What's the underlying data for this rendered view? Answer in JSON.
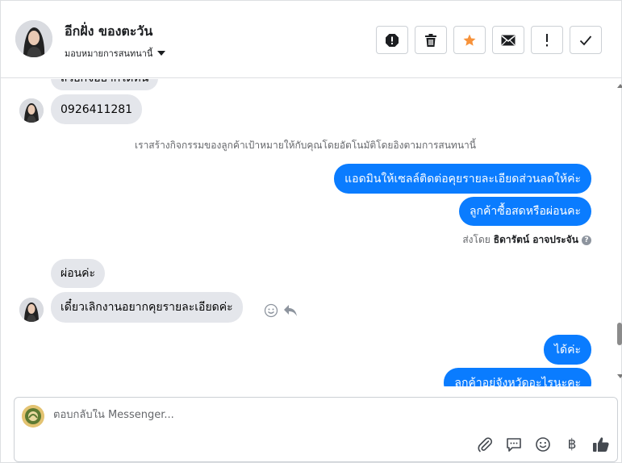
{
  "contact": {
    "name": "อีกฝั่ง ของตะวัน",
    "assign_label": "มอบหมายการสนทนานี้"
  },
  "header_actions": [
    {
      "icon": "alert-octagon-icon"
    },
    {
      "icon": "trash-icon"
    },
    {
      "icon": "star-icon",
      "color": "#f7923a"
    },
    {
      "icon": "envelope-icon"
    },
    {
      "icon": "exclamation-icon"
    },
    {
      "icon": "check-icon"
    }
  ],
  "messages": {
    "partial_top": "สวยกิจอยากได้ทิน",
    "phone": "0926411281",
    "system_note": "เราสร้างกิจกรรมของลูกค้าเป้าหมายให้กับคุณโดยอัตโนมัติโดยอิงตามการสนทนานี้",
    "out_1": "แอดมินให้เซลล์ติดต่อคุยรายละเอียดส่วนลดให้ค่ะ",
    "out_2": "ลูกค้าซื้อสดหรือผ่อนคะ",
    "sent_by_prefix": "ส่งโดย",
    "sent_by_name": "ธิดารัตน์ อาจประจัน",
    "in_1": "ผ่อนค่ะ",
    "in_2": "เดี๋ยวเลิกงานอยากคุยรายละเอียดค่ะ",
    "out_3": "ได้ค่ะ",
    "out_4": "ลูกค้าอยู่จังหวัดอะไรนะคะ"
  },
  "composer": {
    "placeholder": "ตอบกลับใน Messenger...",
    "currency_symbol": "฿"
  },
  "colors": {
    "outgoing_bubble": "#0a7cff",
    "incoming_bubble": "#e4e6eb",
    "star": "#f7923a"
  }
}
